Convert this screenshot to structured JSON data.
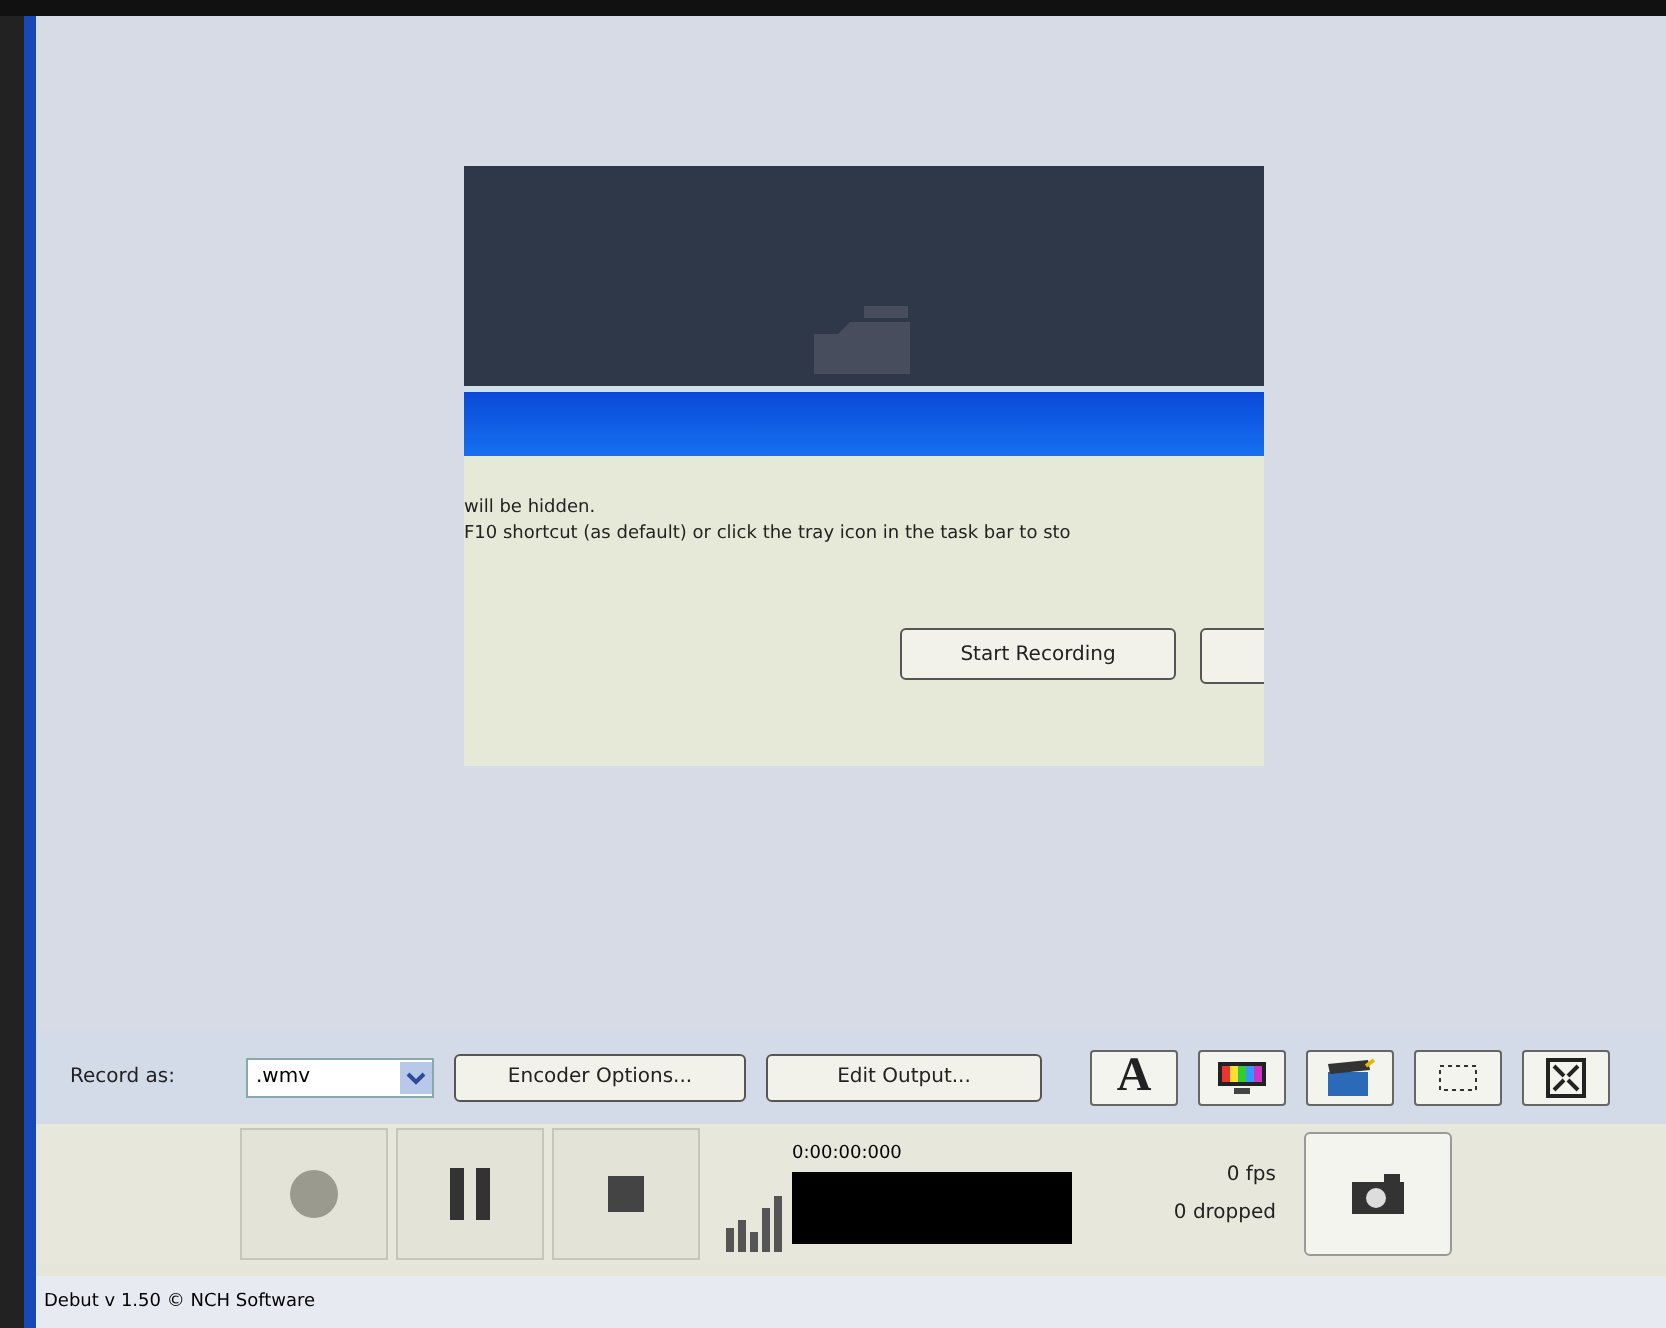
{
  "dialog": {
    "lines": [
      "will be hidden.",
      "F10 shortcut (as default) or click the tray icon in the task bar to sto"
    ],
    "buttons": [
      "Start Recording"
    ]
  },
  "toolbar": {
    "record_as_label": "Record as:",
    "format": ".wmv",
    "buttons": [
      "Encoder Options...",
      "Edit Output..."
    ],
    "text_tool": "A"
  },
  "controls": {
    "time": "0:00:00:000",
    "fps": "0 fps",
    "dropped": "0 dropped"
  },
  "status_bar": "Debut v 1.50 © NCH Software"
}
